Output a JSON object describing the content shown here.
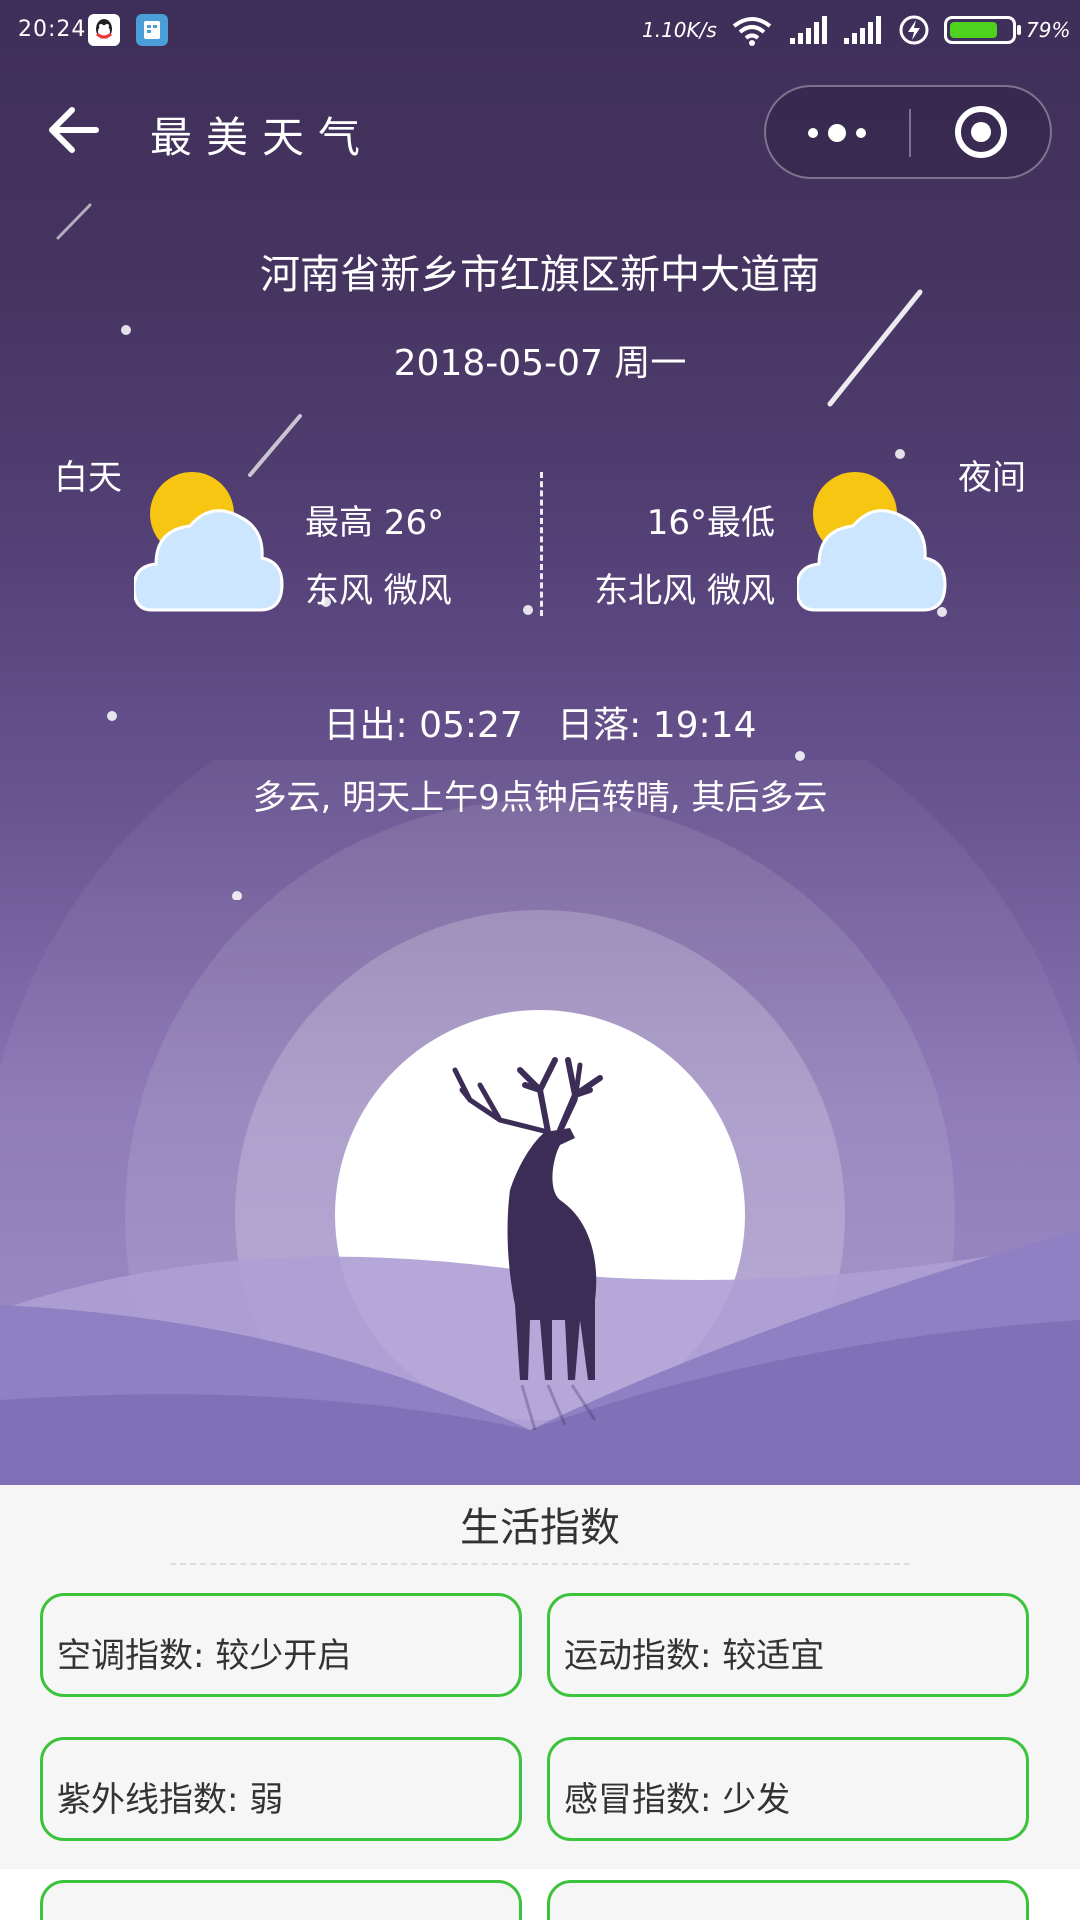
{
  "status_bar": {
    "time": "20:24",
    "network_speed": "1.10K/s",
    "battery_percent": "79%",
    "battery_level": 0.79
  },
  "nav": {
    "title": "最美天气"
  },
  "weather": {
    "location": "河南省新乡市红旗区新中大道南",
    "date": "2018-05-07 周一",
    "day": {
      "label": "白天",
      "temp": "最高 26°",
      "wind": "东风 微风",
      "icon": "partly-cloudy-icon"
    },
    "night": {
      "label": "夜间",
      "temp": "16°最低",
      "wind": "东北风 微风",
      "icon": "partly-cloudy-icon"
    },
    "sun_times": "日出: 05:27   日落: 19:14",
    "forecast": "多云, 明天上午9点钟后转晴, 其后多云"
  },
  "life_index": {
    "title": "生活指数",
    "items": [
      {
        "label": "空调指数: 较少开启"
      },
      {
        "label": "运动指数: 较适宜"
      },
      {
        "label": "紫外线指数: 弱"
      },
      {
        "label": "感冒指数: 少发"
      },
      {
        "label": ""
      },
      {
        "label": ""
      }
    ]
  },
  "colors": {
    "accent_green": "#3cc33c",
    "hero_top": "#3e2f5a",
    "hero_bottom": "#9b8cc7"
  }
}
